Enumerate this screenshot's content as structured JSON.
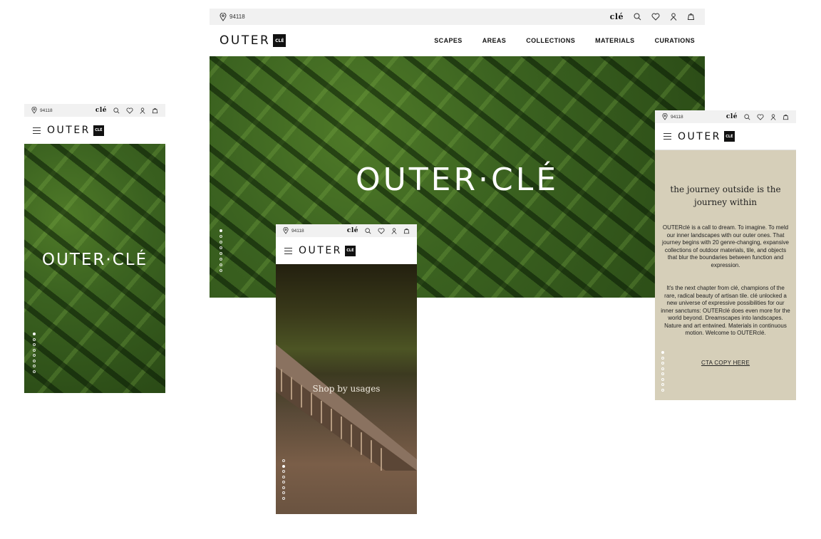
{
  "utility": {
    "zip": "94118",
    "brand_word": "clé"
  },
  "logo": {
    "word": "OUTER",
    "box": "CLÉ"
  },
  "nav": {
    "items": [
      "SCAPES",
      "AREAS",
      "COLLECTIONS",
      "MATERIALS",
      "CURATIONS"
    ]
  },
  "hero": {
    "title": "OUTER·CLÉ"
  },
  "usages": {
    "title": "Shop by usages"
  },
  "about": {
    "heading": "the journey outside is the journey within",
    "p1": "OUTERclé is a call to dream. To imagine. To meld our inner landscapes with our outer ones. That journey begins with 20 genre-changing, expansive collections of outdoor materials, tile, and objects that blur the boundaries between function and expression.",
    "p2": "It's the next chapter from clé, champions of the rare, radical beauty of artisan tile. clé unlocked a new universe of expressive possibilities for our inner sanctums: OUTERclé does even more for the world beyond. Dreamscapes into landscapes. Nature and art entwined. Materials in continuous motion. Welcome to OUTERclé.",
    "cta": "CTA COPY HERE"
  },
  "icons": {
    "location": "location-pin-icon",
    "search": "search-icon",
    "wishlist": "heart-icon",
    "account": "user-icon",
    "cart": "bag-icon",
    "menu": "hamburger-icon"
  },
  "colors": {
    "utility_bg": "#f1f1f1",
    "about_bg": "#d6cfb9",
    "logo_box": "#111111",
    "hedge_green": "#3b6220"
  },
  "slides": {
    "desktop_count": 8,
    "desktop_active": 0,
    "mobile_hero_count": 8,
    "mobile_hero_active": 0,
    "mobile_usages_count": 8,
    "mobile_usages_active": 1,
    "mobile_about_count": 8,
    "mobile_about_active": 0
  }
}
